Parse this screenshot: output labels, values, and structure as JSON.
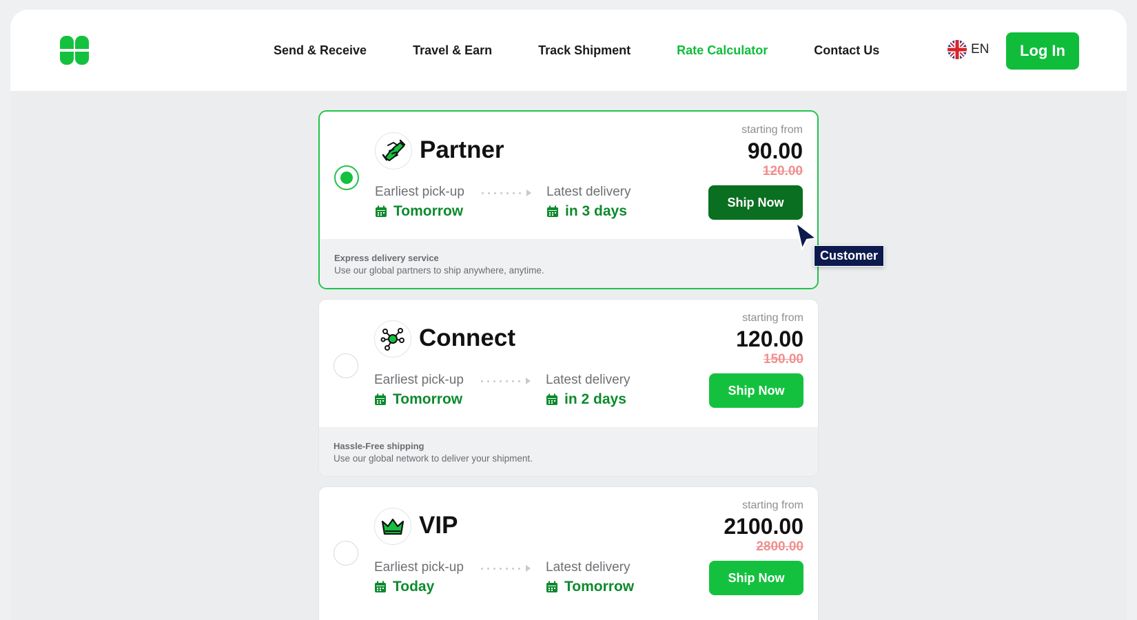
{
  "header": {
    "nav": [
      {
        "label": "Send & Receive",
        "active": false
      },
      {
        "label": "Travel & Earn",
        "active": false
      },
      {
        "label": "Track Shipment",
        "active": false
      },
      {
        "label": "Rate Calculator",
        "active": true
      },
      {
        "label": "Contact Us",
        "active": false
      }
    ],
    "language": "EN",
    "login_label": "Log In"
  },
  "services": [
    {
      "name": "Partner",
      "icon": "handshake-icon",
      "selected": true,
      "starting_label": "starting from",
      "price": "90.00",
      "old_price": "120.00",
      "pickup_label": "Earliest pick-up",
      "pickup_value": "Tomorrow",
      "delivery_label": "Latest delivery",
      "delivery_value": "in 3 days",
      "button_label": "Ship Now",
      "footer_title": "Express delivery service",
      "footer_desc": "Use our global partners to ship anywhere, anytime."
    },
    {
      "name": "Connect",
      "icon": "network-icon",
      "selected": false,
      "starting_label": "starting from",
      "price": "120.00",
      "old_price": "150.00",
      "pickup_label": "Earliest pick-up",
      "pickup_value": "Tomorrow",
      "delivery_label": "Latest delivery",
      "delivery_value": "in 2 days",
      "button_label": "Ship Now",
      "footer_title": "Hassle-Free shipping",
      "footer_desc": "Use our global network to deliver your shipment."
    },
    {
      "name": "VIP",
      "icon": "crown-icon",
      "selected": false,
      "starting_label": "starting from",
      "price": "2100.00",
      "old_price": "2800.00",
      "pickup_label": "Earliest pick-up",
      "pickup_value": "Today",
      "delivery_label": "Latest delivery",
      "delivery_value": "Tomorrow",
      "button_label": "Ship Now"
    }
  ],
  "cursor": {
    "label": "Customer"
  },
  "colors": {
    "brand_green": "#14c13f",
    "dark_green": "#0a6f20",
    "value_green": "#0d8a2d",
    "old_price_red": "#f08f8f",
    "cursor_navy": "#0c1a4d"
  }
}
